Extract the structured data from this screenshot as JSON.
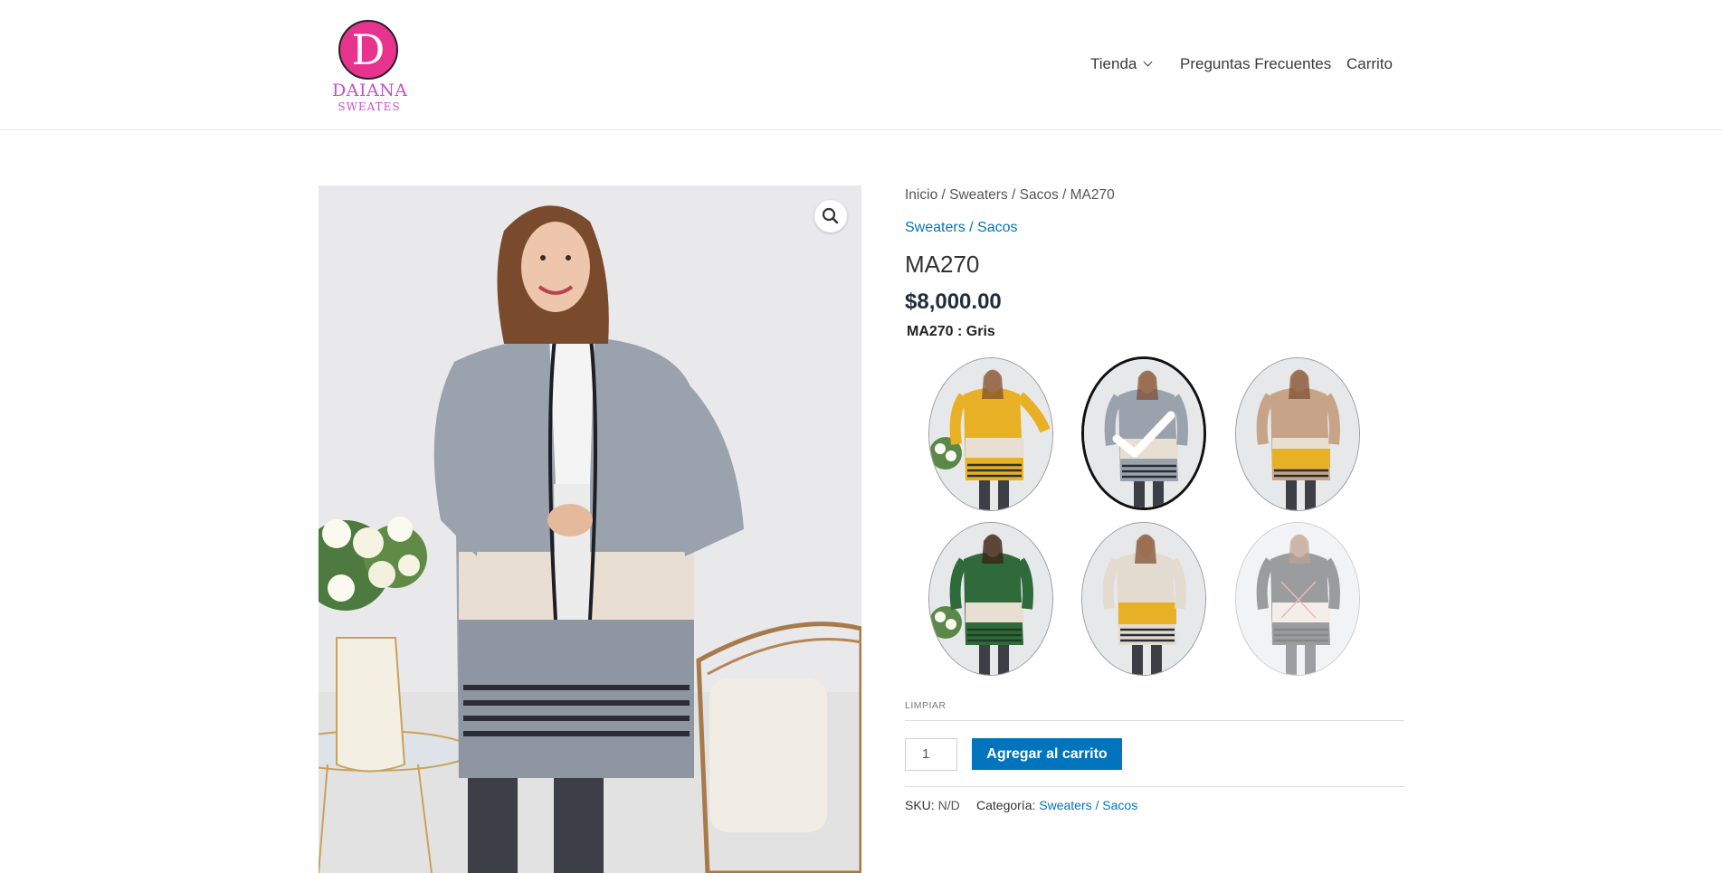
{
  "header": {
    "logo": {
      "letter": "D",
      "name": "DAIANA",
      "sub": "SWEATES"
    },
    "nav": [
      {
        "label": "Tienda",
        "has_dropdown": true
      },
      {
        "label": "Preguntas Frecuentes"
      },
      {
        "label": "Carrito"
      }
    ]
  },
  "product": {
    "breadcrumb": "Inicio / Sweaters / Sacos / MA270",
    "category_link": "Sweaters / Sacos",
    "title": "MA270",
    "price": "$8,000.00",
    "variation_label": "MA270 : Gris",
    "swatches": [
      {
        "color": "Amarillo",
        "state": "available"
      },
      {
        "color": "Gris",
        "state": "selected"
      },
      {
        "color": "Camel",
        "state": "available"
      },
      {
        "color": "Verde",
        "state": "available"
      },
      {
        "color": "Beige",
        "state": "available"
      },
      {
        "color": "Negro",
        "state": "out-of-stock"
      }
    ],
    "clear_label": "LIMPIAR",
    "quantity": "1",
    "add_to_cart_label": "Agregar al carrito",
    "sku_label": "SKU:",
    "sku_value": "N/D",
    "category_label": "Categoría:",
    "category_value": "Sweaters / Sacos"
  },
  "colors": {
    "accent": "#0274be",
    "logo_pink": "#e8338e",
    "logo_text": "#c64fc9"
  },
  "icons": {
    "zoom": "search-icon",
    "dropdown": "chevron-down-icon",
    "selected": "check-icon",
    "unavailable": "cross-icon"
  }
}
